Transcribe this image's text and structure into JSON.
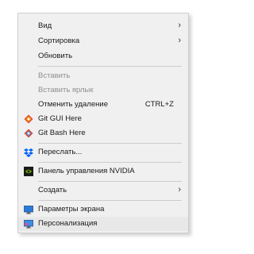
{
  "menu": {
    "items": [
      {
        "label": "Вид",
        "arrow": "›"
      },
      {
        "label": "Сортировка",
        "arrow": "›"
      },
      {
        "label": "Обновить"
      },
      {
        "label": "Вставить"
      },
      {
        "label": "Вставить ярлык"
      },
      {
        "label": "Отменить удаление",
        "shortcut": "CTRL+Z"
      },
      {
        "label": "Git GUI Here",
        "icon": "git-gui-icon"
      },
      {
        "label": "Git Bash Here",
        "icon": "git-bash-icon"
      },
      {
        "label": "Переслать...",
        "icon": "dropbox-icon"
      },
      {
        "label": "Панель управления NVIDIA",
        "icon": "nvidia-icon"
      },
      {
        "label": "Создать",
        "arrow": "›"
      },
      {
        "label": "Параметры экрана",
        "icon": "display-settings-icon"
      },
      {
        "label": "Персонализация",
        "icon": "personalization-icon"
      }
    ]
  },
  "colors": {
    "menu_background": "#f0f0f0",
    "disabled_text": "#8f8f8f",
    "git_red": "#e2452b",
    "dropbox_blue": "#0061ff",
    "nvidia_green": "#76b900",
    "display_blue": "#2b7bd8"
  }
}
